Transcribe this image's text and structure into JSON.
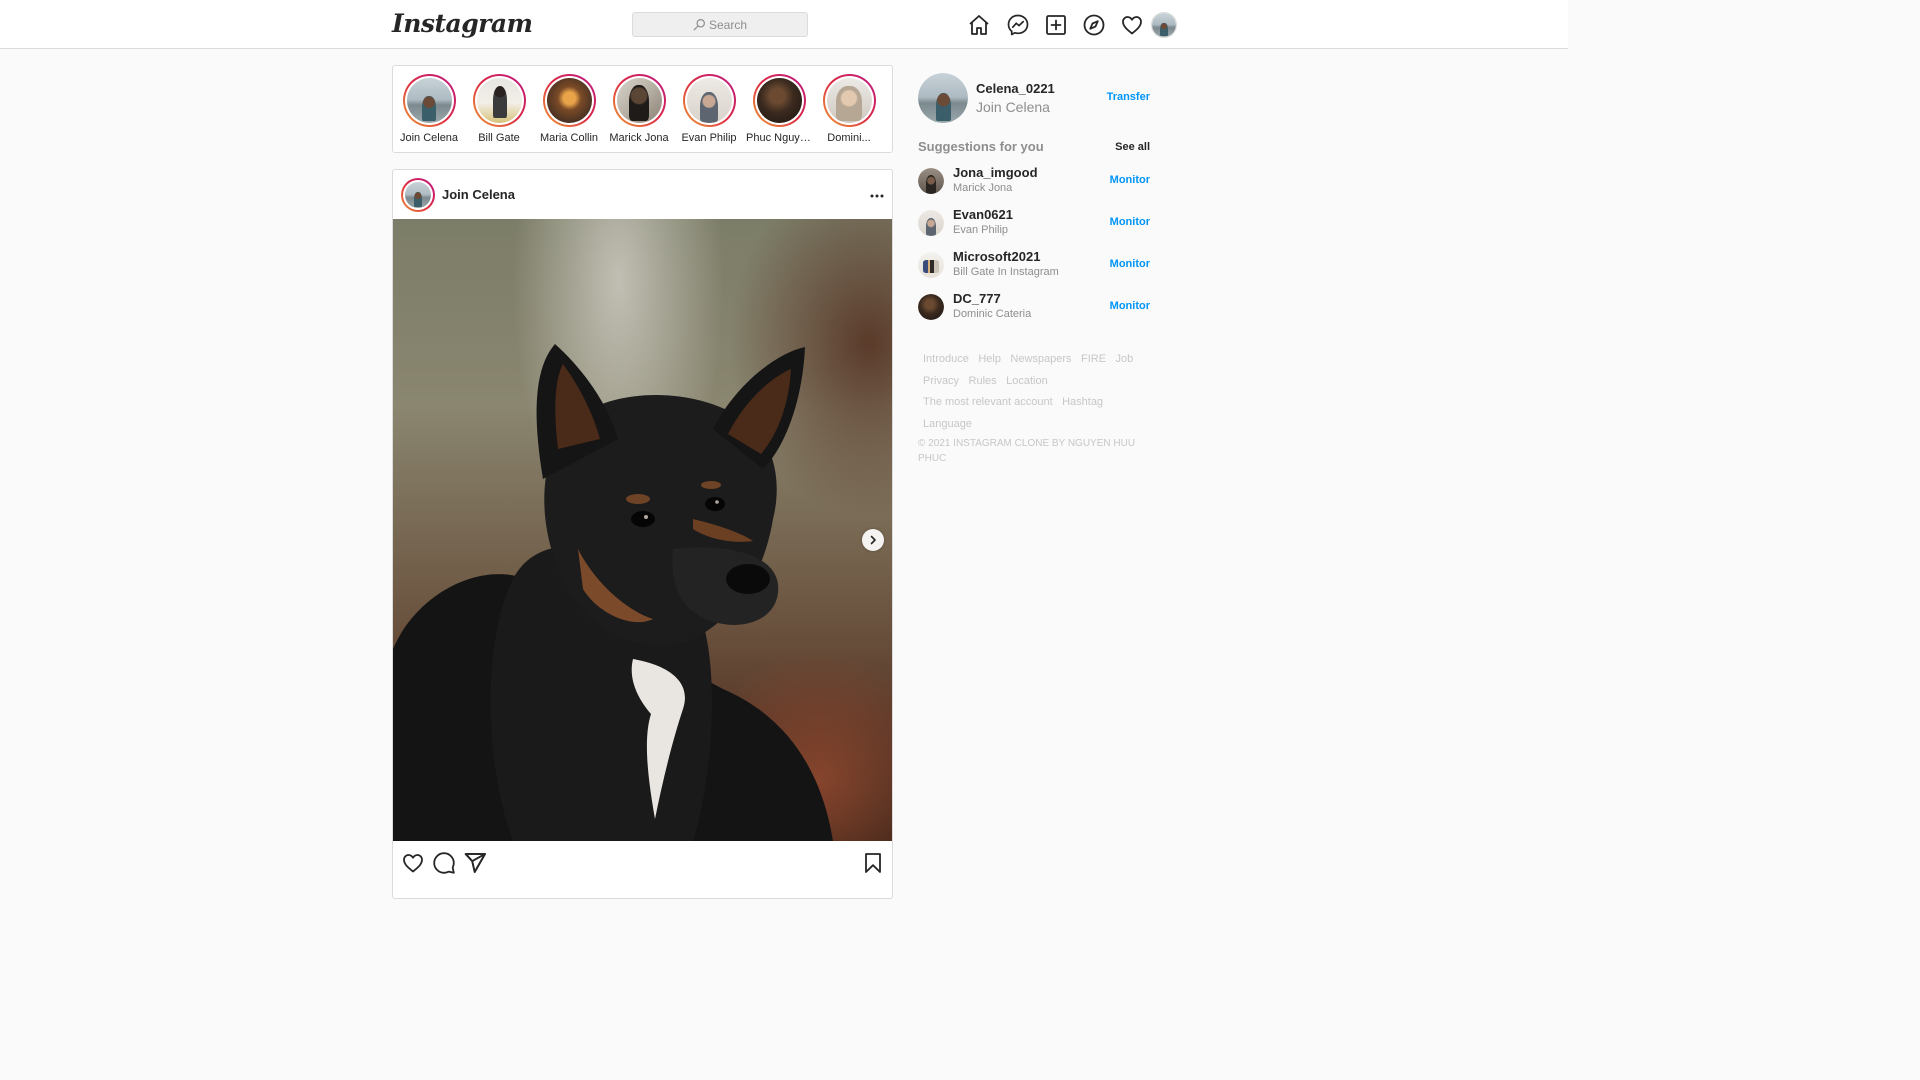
{
  "navbar": {
    "logo": "Instagram",
    "search": {
      "placeholder": "Search",
      "value": ""
    },
    "icons": [
      "home-icon",
      "messenger-icon",
      "new-post-icon",
      "explore-icon",
      "activity-heart-icon"
    ]
  },
  "stories": [
    {
      "name": "Join Celena"
    },
    {
      "name": "Bill Gate"
    },
    {
      "name": "Maria Collin"
    },
    {
      "name": "Marick Jona"
    },
    {
      "name": "Evan Philip"
    },
    {
      "name": "Phuc Nguyen"
    },
    {
      "name": "Domini..."
    }
  ],
  "post": {
    "username": "Join Celena",
    "image_subject": "black dog"
  },
  "sidebar": {
    "profile": {
      "username": "Celena_0221",
      "fullname": "Join Celena",
      "action": "Transfer"
    },
    "suggestions_title": "Suggestions for you",
    "see_all": "See all",
    "suggestions": [
      {
        "username": "Jona_imgood",
        "sub": "Marick Jona",
        "action": "Monitor"
      },
      {
        "username": "Evan0621",
        "sub": "Evan Philip",
        "action": "Monitor"
      },
      {
        "username": "Microsoft2021",
        "sub": "Bill Gate In Instagram",
        "action": "Monitor"
      },
      {
        "username": "DC_777",
        "sub": "Dominic Cateria",
        "action": "Monitor"
      }
    ],
    "footer_links": [
      "Introduce",
      "Help",
      "Newspapers",
      "FIRE",
      "Job",
      "Privacy",
      "Rules",
      "Location",
      "The most relevant account",
      "Hashtag",
      "Language"
    ],
    "copyright": "© 2021 INSTAGRAM CLONE BY NGUYEN HUU PHUC"
  },
  "colors": {
    "accent": "#0095f6",
    "story_ring": "#dc2743",
    "border": "#dbdbdb",
    "muted": "#8e8e8e"
  }
}
